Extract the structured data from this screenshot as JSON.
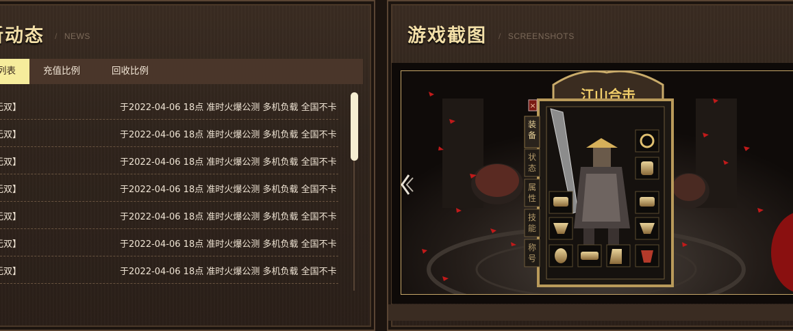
{
  "news": {
    "title": "新动态",
    "subtitle": "NEWS",
    "tabs": [
      {
        "label": "列表",
        "active": true
      },
      {
        "label": "充值比例",
        "active": false
      },
      {
        "label": "回收比例",
        "active": false
      }
    ],
    "items": [
      {
        "tag": "无双】",
        "text": "于2022-04-06 18点 准时火爆公测 多机负载 全国不卡"
      },
      {
        "tag": "无双】",
        "text": "于2022-04-06 18点 准时火爆公测 多机负载 全国不卡"
      },
      {
        "tag": "无双】",
        "text": "于2022-04-06 18点 准时火爆公测 多机负载 全国不卡"
      },
      {
        "tag": "无双】",
        "text": "于2022-04-06 18点 准时火爆公测 多机负载 全国不卡"
      },
      {
        "tag": "无双】",
        "text": "于2022-04-06 18点 准时火爆公测 多机负载 全国不卡"
      },
      {
        "tag": "无双】",
        "text": "于2022-04-06 18点 准时火爆公测 多机负载 全国不卡"
      },
      {
        "tag": "无双】",
        "text": "于2022-04-06 18点 准时火爆公测 多机负载 全国不卡"
      }
    ]
  },
  "screenshots": {
    "title": "游戏截图",
    "subtitle": "SCREENSHOTS",
    "game_window": {
      "side_tabs": [
        "装备",
        "状态",
        "属性",
        "技能",
        "称号"
      ],
      "logo_text": "江山合击"
    }
  },
  "colors": {
    "accent_tab": "#f6ec9c",
    "title": "#f3dfa8",
    "panel_border": "#5a4533"
  }
}
